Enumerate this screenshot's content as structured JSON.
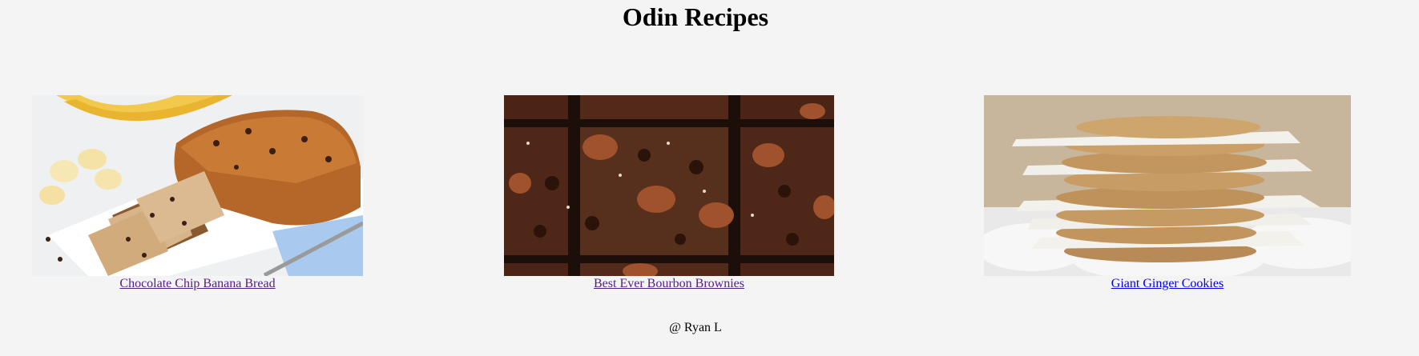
{
  "header": {
    "title": "Odin Recipes"
  },
  "recipes": [
    {
      "label": "Chocolate Chip Banana Bread",
      "link_color": "#551a8b",
      "image": "banana-bread-photo"
    },
    {
      "label": "Best Ever Bourbon Brownies",
      "link_color": "#551a8b",
      "image": "bourbon-brownies-photo"
    },
    {
      "label": "Giant Ginger Cookies",
      "link_color": "#0000ee",
      "image": "ginger-cookies-photo"
    }
  ],
  "footer": {
    "text": "@ Ryan L"
  },
  "colors": {
    "background": "#f4f4f4",
    "visited_link": "#551a8b",
    "link": "#0000ee"
  }
}
